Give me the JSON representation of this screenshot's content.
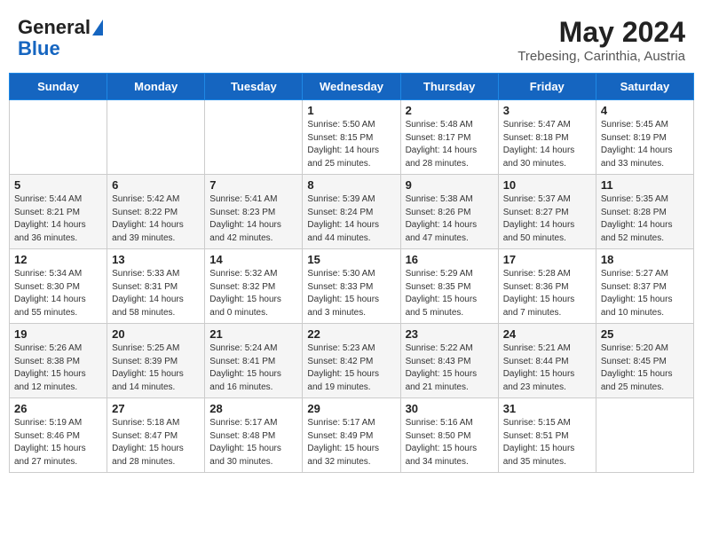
{
  "header": {
    "logo_line1": "General",
    "logo_line2": "Blue",
    "month_year": "May 2024",
    "location": "Trebesing, Carinthia, Austria"
  },
  "days_of_week": [
    "Sunday",
    "Monday",
    "Tuesday",
    "Wednesday",
    "Thursday",
    "Friday",
    "Saturday"
  ],
  "weeks": [
    [
      {
        "day": "",
        "content": ""
      },
      {
        "day": "",
        "content": ""
      },
      {
        "day": "",
        "content": ""
      },
      {
        "day": "1",
        "content": "Sunrise: 5:50 AM\nSunset: 8:15 PM\nDaylight: 14 hours\nand 25 minutes."
      },
      {
        "day": "2",
        "content": "Sunrise: 5:48 AM\nSunset: 8:17 PM\nDaylight: 14 hours\nand 28 minutes."
      },
      {
        "day": "3",
        "content": "Sunrise: 5:47 AM\nSunset: 8:18 PM\nDaylight: 14 hours\nand 30 minutes."
      },
      {
        "day": "4",
        "content": "Sunrise: 5:45 AM\nSunset: 8:19 PM\nDaylight: 14 hours\nand 33 minutes."
      }
    ],
    [
      {
        "day": "5",
        "content": "Sunrise: 5:44 AM\nSunset: 8:21 PM\nDaylight: 14 hours\nand 36 minutes."
      },
      {
        "day": "6",
        "content": "Sunrise: 5:42 AM\nSunset: 8:22 PM\nDaylight: 14 hours\nand 39 minutes."
      },
      {
        "day": "7",
        "content": "Sunrise: 5:41 AM\nSunset: 8:23 PM\nDaylight: 14 hours\nand 42 minutes."
      },
      {
        "day": "8",
        "content": "Sunrise: 5:39 AM\nSunset: 8:24 PM\nDaylight: 14 hours\nand 44 minutes."
      },
      {
        "day": "9",
        "content": "Sunrise: 5:38 AM\nSunset: 8:26 PM\nDaylight: 14 hours\nand 47 minutes."
      },
      {
        "day": "10",
        "content": "Sunrise: 5:37 AM\nSunset: 8:27 PM\nDaylight: 14 hours\nand 50 minutes."
      },
      {
        "day": "11",
        "content": "Sunrise: 5:35 AM\nSunset: 8:28 PM\nDaylight: 14 hours\nand 52 minutes."
      }
    ],
    [
      {
        "day": "12",
        "content": "Sunrise: 5:34 AM\nSunset: 8:30 PM\nDaylight: 14 hours\nand 55 minutes."
      },
      {
        "day": "13",
        "content": "Sunrise: 5:33 AM\nSunset: 8:31 PM\nDaylight: 14 hours\nand 58 minutes."
      },
      {
        "day": "14",
        "content": "Sunrise: 5:32 AM\nSunset: 8:32 PM\nDaylight: 15 hours\nand 0 minutes."
      },
      {
        "day": "15",
        "content": "Sunrise: 5:30 AM\nSunset: 8:33 PM\nDaylight: 15 hours\nand 3 minutes."
      },
      {
        "day": "16",
        "content": "Sunrise: 5:29 AM\nSunset: 8:35 PM\nDaylight: 15 hours\nand 5 minutes."
      },
      {
        "day": "17",
        "content": "Sunrise: 5:28 AM\nSunset: 8:36 PM\nDaylight: 15 hours\nand 7 minutes."
      },
      {
        "day": "18",
        "content": "Sunrise: 5:27 AM\nSunset: 8:37 PM\nDaylight: 15 hours\nand 10 minutes."
      }
    ],
    [
      {
        "day": "19",
        "content": "Sunrise: 5:26 AM\nSunset: 8:38 PM\nDaylight: 15 hours\nand 12 minutes."
      },
      {
        "day": "20",
        "content": "Sunrise: 5:25 AM\nSunset: 8:39 PM\nDaylight: 15 hours\nand 14 minutes."
      },
      {
        "day": "21",
        "content": "Sunrise: 5:24 AM\nSunset: 8:41 PM\nDaylight: 15 hours\nand 16 minutes."
      },
      {
        "day": "22",
        "content": "Sunrise: 5:23 AM\nSunset: 8:42 PM\nDaylight: 15 hours\nand 19 minutes."
      },
      {
        "day": "23",
        "content": "Sunrise: 5:22 AM\nSunset: 8:43 PM\nDaylight: 15 hours\nand 21 minutes."
      },
      {
        "day": "24",
        "content": "Sunrise: 5:21 AM\nSunset: 8:44 PM\nDaylight: 15 hours\nand 23 minutes."
      },
      {
        "day": "25",
        "content": "Sunrise: 5:20 AM\nSunset: 8:45 PM\nDaylight: 15 hours\nand 25 minutes."
      }
    ],
    [
      {
        "day": "26",
        "content": "Sunrise: 5:19 AM\nSunset: 8:46 PM\nDaylight: 15 hours\nand 27 minutes."
      },
      {
        "day": "27",
        "content": "Sunrise: 5:18 AM\nSunset: 8:47 PM\nDaylight: 15 hours\nand 28 minutes."
      },
      {
        "day": "28",
        "content": "Sunrise: 5:17 AM\nSunset: 8:48 PM\nDaylight: 15 hours\nand 30 minutes."
      },
      {
        "day": "29",
        "content": "Sunrise: 5:17 AM\nSunset: 8:49 PM\nDaylight: 15 hours\nand 32 minutes."
      },
      {
        "day": "30",
        "content": "Sunrise: 5:16 AM\nSunset: 8:50 PM\nDaylight: 15 hours\nand 34 minutes."
      },
      {
        "day": "31",
        "content": "Sunrise: 5:15 AM\nSunset: 8:51 PM\nDaylight: 15 hours\nand 35 minutes."
      },
      {
        "day": "",
        "content": ""
      }
    ]
  ]
}
